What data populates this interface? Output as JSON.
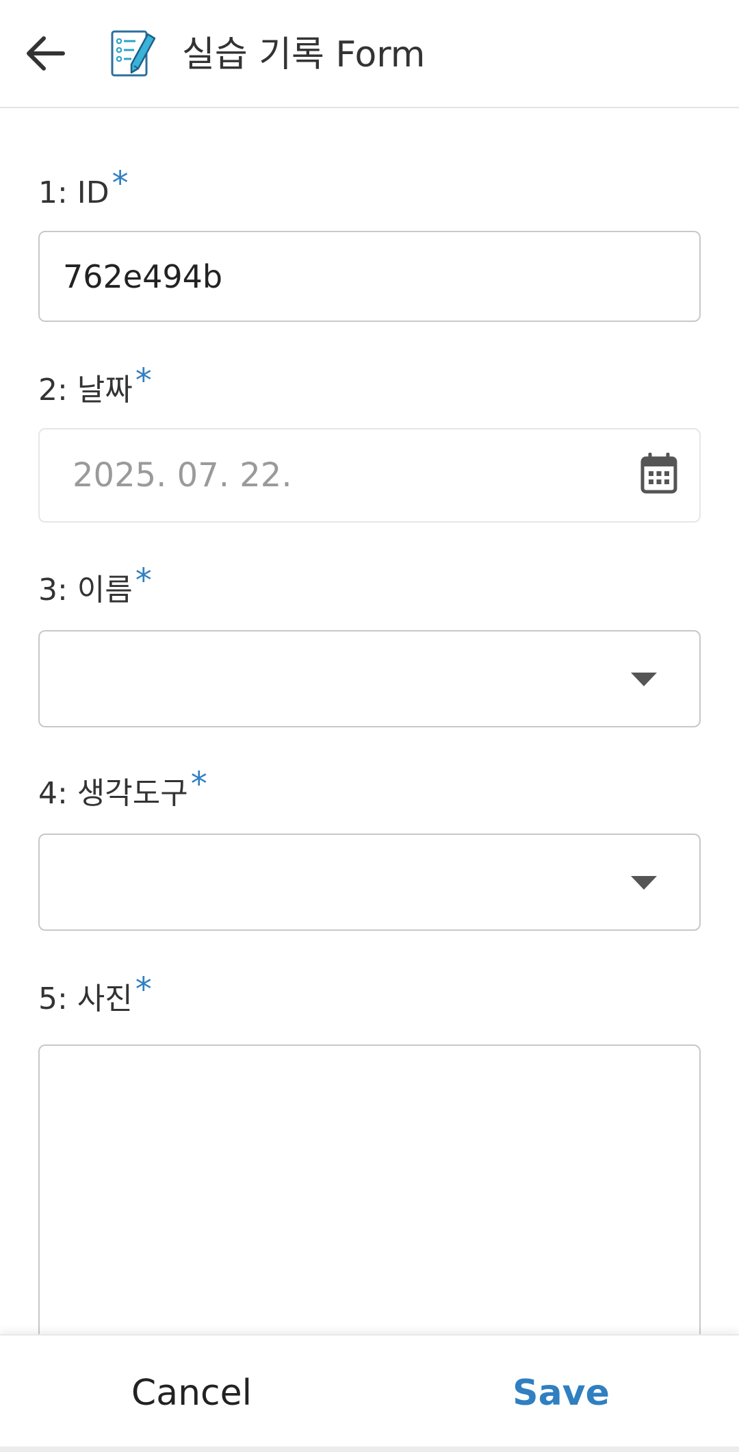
{
  "header": {
    "title": "실습 기록 Form",
    "back_icon": "arrow-left-icon",
    "form_icon": "form-checklist-pencil-icon"
  },
  "fields": [
    {
      "label": "1: ID",
      "required_mark": "*",
      "value": "762e494b",
      "type": "text"
    },
    {
      "label": "2: 날짜",
      "required_mark": "*",
      "value": "2025. 07. 22.",
      "type": "date",
      "icon": "calendar-icon"
    },
    {
      "label": "3: 이름",
      "required_mark": "*",
      "value": "",
      "type": "dropdown",
      "icon": "caret-down-icon"
    },
    {
      "label": "4: 생각도구",
      "required_mark": "*",
      "value": "",
      "type": "dropdown",
      "icon": "caret-down-icon"
    },
    {
      "label": "5: 사진",
      "required_mark": "*",
      "value": "",
      "type": "image"
    }
  ],
  "footer": {
    "cancel_label": "Cancel",
    "save_label": "Save"
  },
  "colors": {
    "accent": "#2f7fc1",
    "text": "#333333",
    "border": "#c8c8c8",
    "placeholder": "#9a9a9a"
  }
}
